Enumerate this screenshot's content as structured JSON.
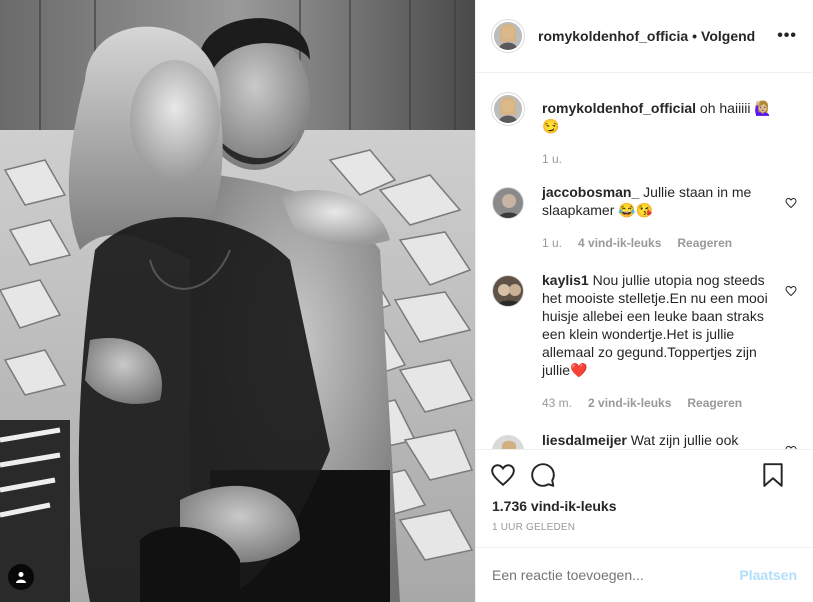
{
  "post": {
    "author": "romykoldenhof_officia",
    "separator": "•",
    "follow_status": "Volgend",
    "more_icon": "more-dots-icon"
  },
  "comments": [
    {
      "username": "romykoldenhof_official",
      "text": "oh haiiiii 🙋🏼‍♀️😏",
      "time": "1 u.",
      "likes": "",
      "reply": ""
    },
    {
      "username": "jaccobosman_",
      "text": "Jullie staan in me slaapkamer 😂😘",
      "time": "1 u.",
      "likes": "4 vind-ik-leuks",
      "reply": "Reageren"
    },
    {
      "username": "kaylis1",
      "text": "Nou jullie utopia nog steeds het mooiste stelletje.En nu een mooi huisje allebei een leuke baan straks een klein wondertje.Het is jullie allemaal zo gegund.Toppertjes zijn jullie❤️",
      "time": "43 m.",
      "likes": "2 vind-ik-leuks",
      "reply": "Reageren"
    },
    {
      "username": "liesdalmeijer",
      "text": "Wat zijn jullie ook",
      "time": "",
      "likes": "",
      "reply": ""
    }
  ],
  "likes_count": "1.736 vind-ik-leuks",
  "post_time": "1 UUR GELEDEN",
  "add_comment": {
    "placeholder": "Een reactie toevoegen...",
    "post_label": "Plaatsen"
  },
  "colors": {
    "post_button_disabled": "#b2dffc",
    "meta_gray": "#999999",
    "text": "#262626",
    "divider": "#efefef"
  }
}
